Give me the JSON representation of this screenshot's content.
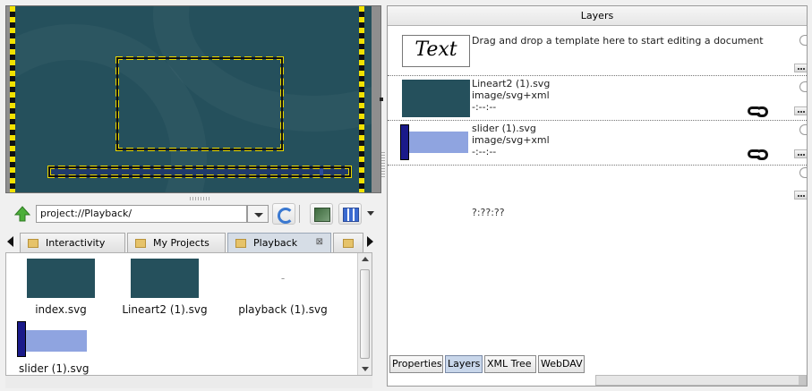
{
  "path": {
    "value": "project://Playback/"
  },
  "tabs": [
    {
      "label": "Interactivity"
    },
    {
      "label": "My Projects"
    },
    {
      "label": "Playback",
      "close": "⊠"
    },
    {
      "label": ""
    }
  ],
  "files": [
    {
      "label": "index.svg",
      "icon": "svg-thumbnail"
    },
    {
      "label": "Lineart2 (1).svg",
      "icon": "svg-thumbnail"
    },
    {
      "label": "playback (1).svg",
      "icon": "empty-thumbnail",
      "placeholder": "-"
    },
    {
      "label": "slider (1).svg",
      "icon": "slider-thumbnail"
    }
  ],
  "layers": {
    "header": "Layers",
    "template_text": "Text",
    "template_hint": "Drag and drop a template here to start editing a document",
    "items": [
      {
        "name": "Lineart2 (1).svg",
        "type": "image/svg+xml",
        "time": "-:--:--"
      },
      {
        "name": "slider (1).svg",
        "type": "image/svg+xml",
        "time": "-:--:--"
      }
    ],
    "empty_time": "?:??:??"
  },
  "bottom_tabs": [
    {
      "label": "Properties"
    },
    {
      "label": "Layers",
      "active": true
    },
    {
      "label": "XML Tree"
    },
    {
      "label": "WebDAV"
    }
  ],
  "colors": {
    "canvas_bg": "#25505c",
    "hazard_yellow": "#f2e200",
    "slider_dark": "#1a1a8a",
    "slider_light": "#8fa4e0"
  }
}
